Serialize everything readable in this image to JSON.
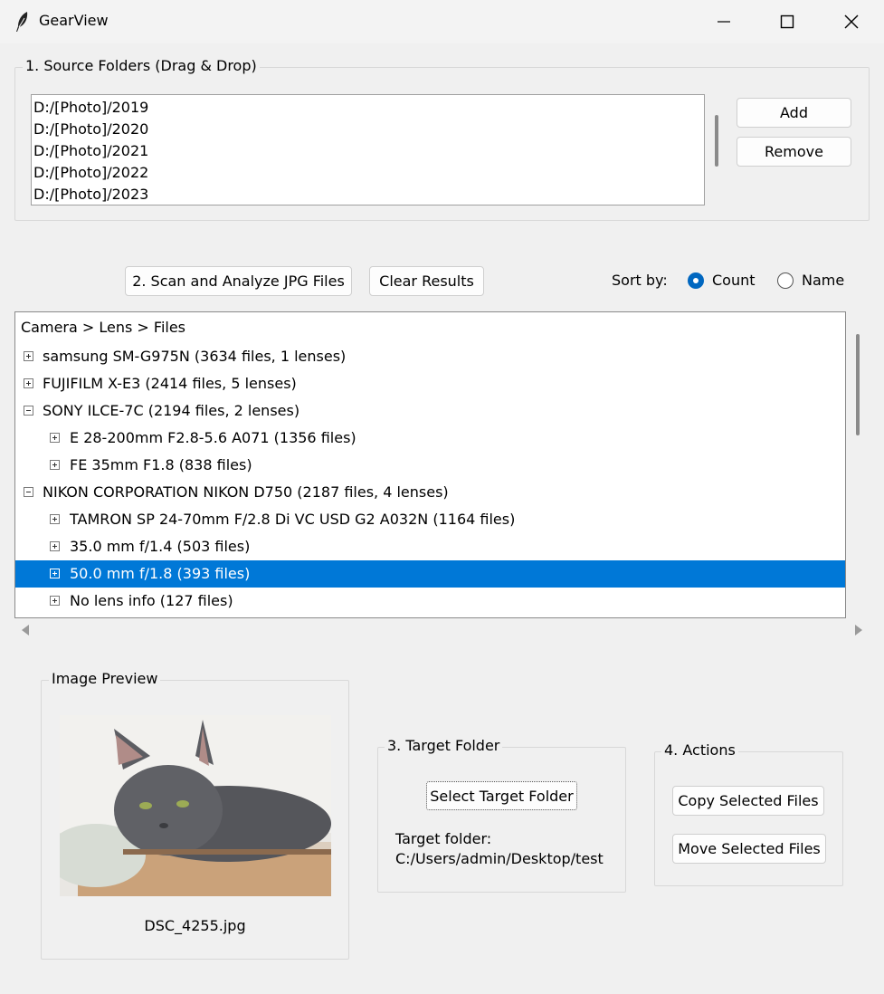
{
  "window": {
    "title": "GearView",
    "icon": "feather-icon"
  },
  "source": {
    "group_label": "1. Source Folders (Drag & Drop)",
    "folders": [
      "D:/[Photo]/2019",
      "D:/[Photo]/2020",
      "D:/[Photo]/2021",
      "D:/[Photo]/2022",
      "D:/[Photo]/2023"
    ],
    "add_label": "Add",
    "remove_label": "Remove"
  },
  "scan": {
    "scan_label": "2. Scan and Analyze JPG Files",
    "clear_label": "Clear Results",
    "sort_label": "Sort by:",
    "sort_options": [
      "Count",
      "Name"
    ],
    "sort_selected": "Count"
  },
  "tree": {
    "header": "Camera > Lens > Files",
    "rows": [
      {
        "text": "samsung SM-G975N (3634 files, 1 lenses)",
        "level": 0,
        "expanded": false,
        "selected": false
      },
      {
        "text": "FUJIFILM X-E3 (2414 files, 5 lenses)",
        "level": 0,
        "expanded": false,
        "selected": false
      },
      {
        "text": "SONY ILCE-7C (2194 files, 2 lenses)",
        "level": 0,
        "expanded": true,
        "selected": false
      },
      {
        "text": "E 28-200mm F2.8-5.6 A071 (1356 files)",
        "level": 1,
        "expanded": false,
        "selected": false
      },
      {
        "text": "FE 35mm F1.8 (838 files)",
        "level": 1,
        "expanded": false,
        "selected": false
      },
      {
        "text": "NIKON CORPORATION NIKON D750 (2187 files, 4 lenses)",
        "level": 0,
        "expanded": true,
        "selected": false
      },
      {
        "text": "TAMRON SP 24-70mm F/2.8 Di VC USD G2 A032N (1164 files)",
        "level": 1,
        "expanded": false,
        "selected": false
      },
      {
        "text": "35.0 mm f/1.4 (503 files)",
        "level": 1,
        "expanded": false,
        "selected": false
      },
      {
        "text": "50.0 mm f/1.8 (393 files)",
        "level": 1,
        "expanded": false,
        "selected": true
      },
      {
        "text": "No lens info (127 files)",
        "level": 1,
        "expanded": false,
        "selected": false
      }
    ]
  },
  "preview": {
    "group_label": "Image Preview",
    "filename": "DSC_4255.jpg"
  },
  "target": {
    "group_label": "3. Target Folder",
    "select_label": "Select Target Folder",
    "caption": "Target folder:",
    "path": "C:/Users/admin/Desktop/test"
  },
  "actions": {
    "group_label": "4. Actions",
    "copy_label": "Copy Selected Files",
    "move_label": "Move Selected Files"
  },
  "colors": {
    "accent": "#0078d7",
    "selection": "#0078d7",
    "background": "#f0f0f0"
  }
}
